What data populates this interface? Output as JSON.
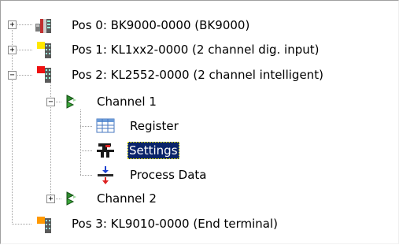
{
  "tree": {
    "items": [
      {
        "label": "Pos 0: BK9000-0000  (BK9000)",
        "expander": "+",
        "icon": "bus-coupler-icon"
      },
      {
        "label": "Pos 1: KL1xx2-0000  (2 channel dig. input)",
        "expander": "+",
        "icon": "digital-input-terminal-icon"
      },
      {
        "label": "Pos 2: KL2552-0000  (2 channel intelligent)",
        "expander": "−",
        "icon": "intelligent-terminal-icon"
      },
      {
        "label": "Channel 1",
        "expander": "−",
        "icon": "channel-icon"
      },
      {
        "label": "Register",
        "icon": "register-table-icon"
      },
      {
        "label": "Settings",
        "icon": "settings-icon",
        "selected": true
      },
      {
        "label": "Process Data",
        "icon": "process-data-icon"
      },
      {
        "label": "Channel 2",
        "expander": "+",
        "icon": "channel-icon"
      },
      {
        "label": "Pos 3: KL9010-0000  (End terminal)",
        "icon": "end-terminal-icon"
      }
    ]
  },
  "colors": {
    "selection": "#0a246a",
    "terminal_yellow": "#ffe800",
    "terminal_red": "#ee1111",
    "terminal_orange": "#ff9900",
    "channel_green": "#2e8b2e",
    "tree_lines": "#a0a0a0"
  }
}
